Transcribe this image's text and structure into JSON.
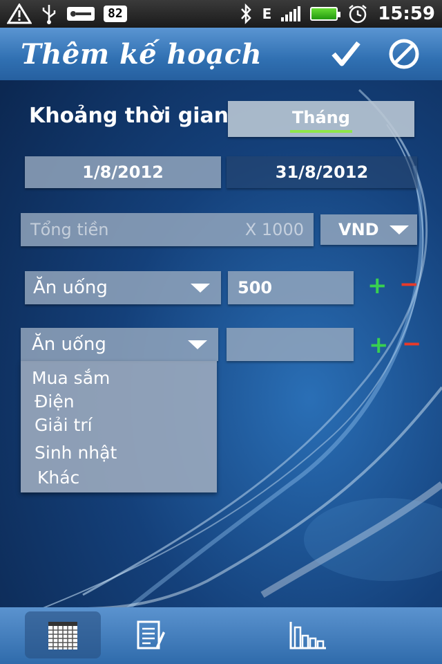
{
  "status_bar": {
    "icons": [
      "warning-icon",
      "usb-icon",
      "key-icon",
      "bluetooth-icon",
      "data-e-icon",
      "signal-icon",
      "battery-icon",
      "alarm-icon"
    ],
    "badge": "82",
    "network": "E",
    "time": "15:59"
  },
  "header": {
    "title": "Thêm kế hoạch",
    "accept_icon": "check-icon",
    "cancel_icon": "prohibited-icon"
  },
  "period": {
    "label": "Khoảng thời gian",
    "mode": "Tháng",
    "from": "1/8/2012",
    "to": "31/8/2012"
  },
  "total": {
    "placeholder": "Tổng tiền",
    "multiplier": "X 1000",
    "currency": "VND"
  },
  "rows": [
    {
      "category": "Ăn uống",
      "amount": "500"
    },
    {
      "category": "Ăn uống",
      "amount": ""
    }
  ],
  "dropdown_options": [
    "Mua sắm",
    "Điện",
    "Giải trí",
    "Sinh nhật",
    "Khác"
  ],
  "bottom_tabs": [
    {
      "icon": "calendar-icon",
      "active": true
    },
    {
      "icon": "notepad-icon",
      "active": false
    },
    {
      "icon": "bar-chart-icon",
      "active": false
    }
  ],
  "colors": {
    "accent_green": "#8ee64a",
    "plus_green": "#38d050",
    "minus_red": "#e83a2a",
    "header_blue": "#3070b2"
  }
}
